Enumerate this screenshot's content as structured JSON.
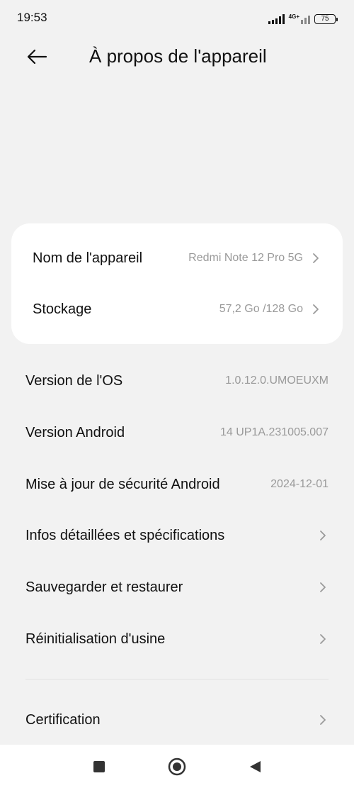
{
  "status_bar": {
    "time": "19:53",
    "network_label": "4G+",
    "battery_level": "75"
  },
  "header": {
    "title": "À propos de l'appareil"
  },
  "card": {
    "items": [
      {
        "label": "Nom de l'appareil",
        "value": "Redmi Note 12 Pro 5G"
      },
      {
        "label": "Stockage",
        "value": "57,2 Go /128 Go"
      }
    ]
  },
  "info": {
    "items": [
      {
        "label": "Version de l'OS",
        "value": "1.0.12.0.UMOEUXM"
      },
      {
        "label": "Version Android",
        "value": "14 UP1A.231005.007"
      },
      {
        "label": "Mise à jour de sécurité Android",
        "value": "2024-12-01"
      }
    ]
  },
  "links": {
    "items": [
      {
        "label": "Infos détaillées et spécifications"
      },
      {
        "label": "Sauvegarder et restaurer"
      },
      {
        "label": "Réinitialisation d'usine"
      },
      {
        "label": "Certification"
      }
    ]
  },
  "icons": {
    "back": "arrow-left-icon",
    "chevron": "chevron-right-icon",
    "nav_recents": "square-icon",
    "nav_home": "circle-icon",
    "nav_back": "triangle-left-icon"
  },
  "colors": {
    "background": "#f2f2f2",
    "card": "#ffffff",
    "secondary_text": "#9a9a9a"
  }
}
